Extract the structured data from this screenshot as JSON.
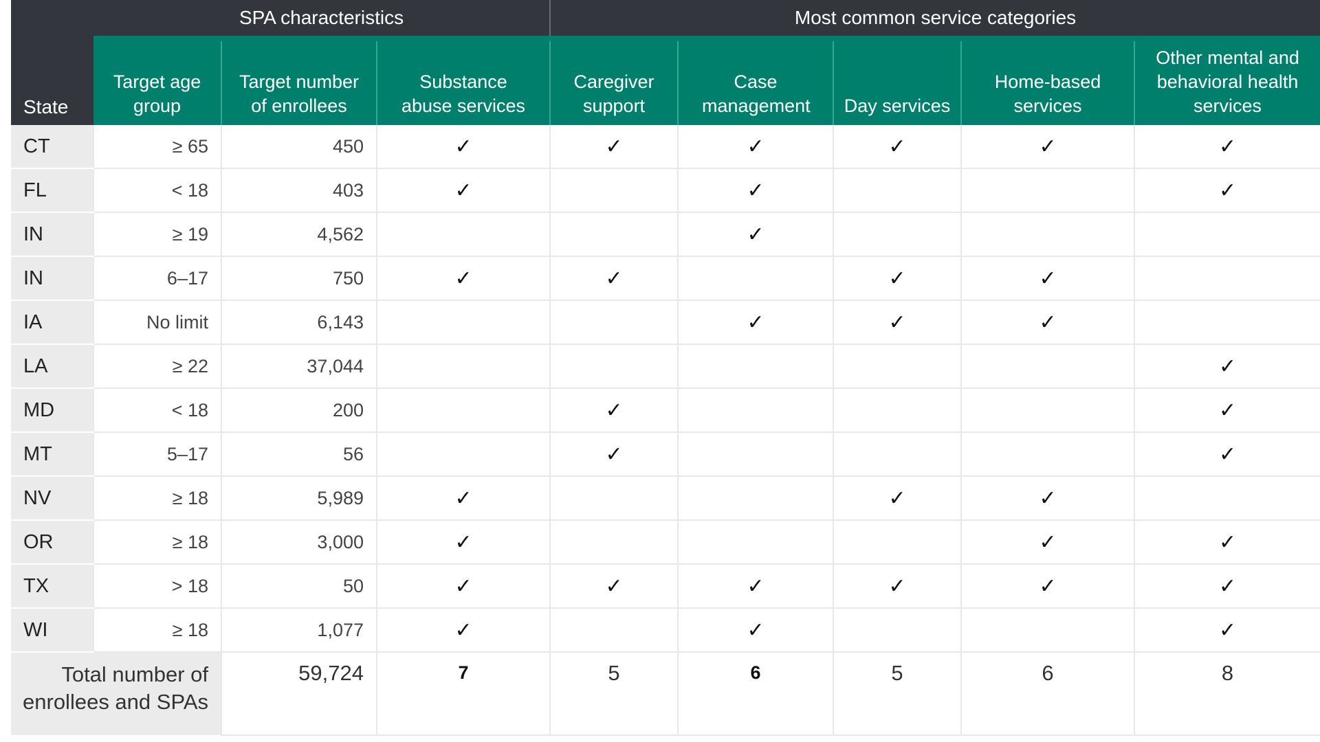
{
  "header": {
    "state_label": "State",
    "group_spa": "SPA characteristics",
    "group_services": "Most common service categories",
    "columns": [
      "Target age group",
      "Target number of enrollees",
      "Substance abuse services",
      "Caregiver support",
      "Case management",
      "Day services",
      "Home-based services",
      "Other mental and behavioral health services"
    ]
  },
  "check_glyph": "✓",
  "rows": [
    {
      "state": "CT",
      "age": "≥ 65",
      "enrollees": "450",
      "checks": [
        true,
        true,
        true,
        true,
        true,
        true
      ]
    },
    {
      "state": "FL",
      "age": "< 18",
      "enrollees": "403",
      "checks": [
        true,
        false,
        true,
        false,
        false,
        true
      ]
    },
    {
      "state": "IN",
      "age": "≥ 19",
      "enrollees": "4,562",
      "checks": [
        false,
        false,
        true,
        false,
        false,
        false
      ]
    },
    {
      "state": "IN",
      "age": "6–17",
      "enrollees": "750",
      "checks": [
        true,
        true,
        false,
        true,
        true,
        false
      ]
    },
    {
      "state": "IA",
      "age": "No limit",
      "enrollees": "6,143",
      "checks": [
        false,
        false,
        true,
        true,
        true,
        false
      ]
    },
    {
      "state": "LA",
      "age": "≥ 22",
      "enrollees": "37,044",
      "checks": [
        false,
        false,
        false,
        false,
        false,
        true
      ]
    },
    {
      "state": "MD",
      "age": "< 18",
      "enrollees": "200",
      "checks": [
        false,
        true,
        false,
        false,
        false,
        true
      ]
    },
    {
      "state": "MT",
      "age": "5–17",
      "enrollees": "56",
      "checks": [
        false,
        true,
        false,
        false,
        false,
        true
      ]
    },
    {
      "state": "NV",
      "age": "≥ 18",
      "enrollees": "5,989",
      "checks": [
        true,
        false,
        false,
        true,
        true,
        false
      ]
    },
    {
      "state": "OR",
      "age": "≥ 18",
      "enrollees": "3,000",
      "checks": [
        true,
        false,
        false,
        false,
        true,
        true
      ]
    },
    {
      "state": "TX",
      "age": "> 18",
      "enrollees": "50",
      "checks": [
        true,
        true,
        true,
        true,
        true,
        true
      ]
    },
    {
      "state": "WI",
      "age": "≥ 18",
      "enrollees": "1,077",
      "checks": [
        true,
        false,
        true,
        false,
        false,
        true
      ]
    }
  ],
  "total": {
    "label_line1": "Total number of",
    "label_line2": "enrollees and SPAs",
    "enrollees": "59,724",
    "counts": [
      "7",
      "5",
      "6",
      "5",
      "6",
      "8"
    ]
  }
}
